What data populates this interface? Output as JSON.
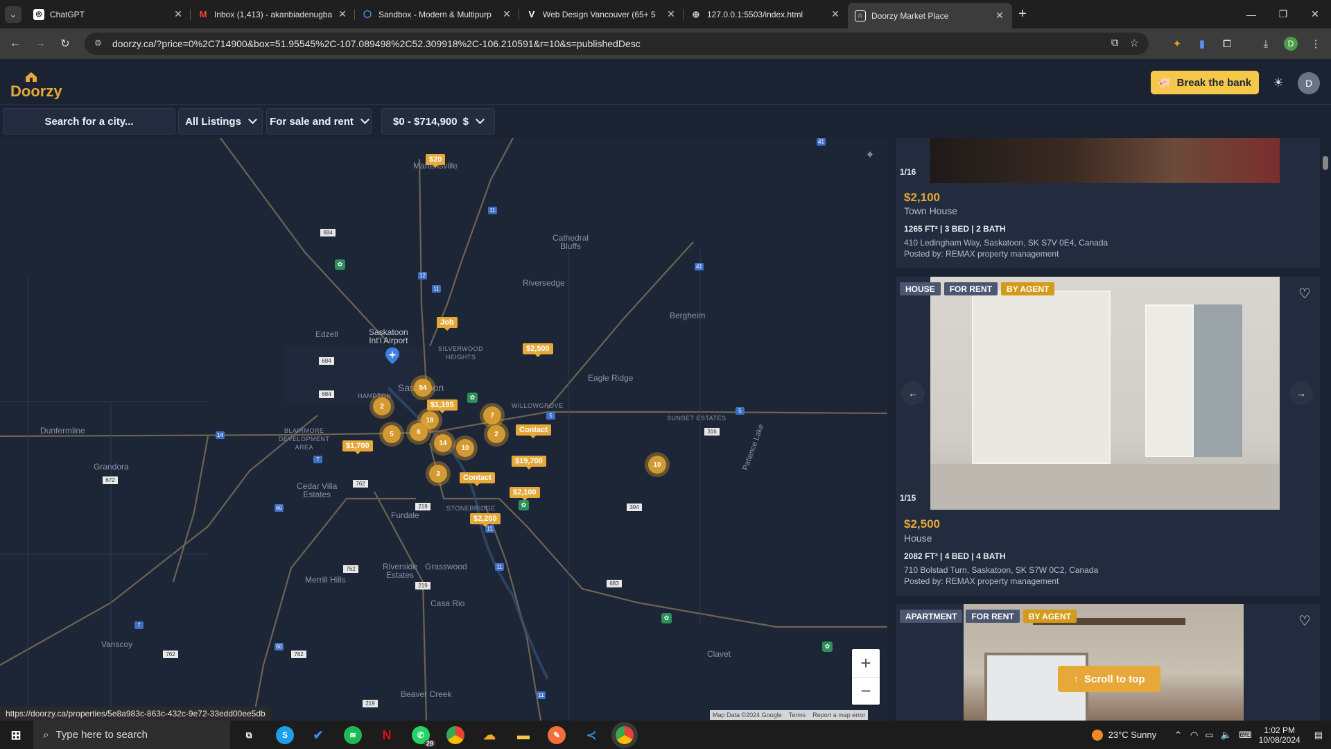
{
  "browser": {
    "tabs": [
      {
        "title": "ChatGPT",
        "favicon": "chatgpt-icon",
        "active": false
      },
      {
        "title": "Inbox (1,413) - akanbiadenugba",
        "favicon": "gmail-icon",
        "active": false
      },
      {
        "title": "Sandbox - Modern & Multipurp",
        "favicon": "sandbox-icon",
        "active": false
      },
      {
        "title": "Web Design Vancouver (65+ 5",
        "favicon": "vercel-icon",
        "active": false
      },
      {
        "title": "127.0.0.1:5503/index.html",
        "favicon": "globe-icon",
        "active": false
      },
      {
        "title": "Doorzy Market Place",
        "favicon": "doorzy-icon",
        "active": true
      }
    ],
    "url": "doorzy.ca/?price=0%2C714900&box=51.95545%2C-107.089498%2C52.309918%2C-106.210591&r=10&s=publishedDesc",
    "profile_initial": "D",
    "status_url": "https://doorzy.ca/properties/5e8a983c-863c-432c-9e72-33edd00ee5db"
  },
  "header": {
    "logo_text": "Doorzy",
    "break_bank_label": "Break the bank",
    "avatar_initial": "D"
  },
  "filters": {
    "search_placeholder": "Search for a city...",
    "listings": "All Listings",
    "sale_rent": "For sale and rent",
    "price_range": "$0 - $714,900",
    "currency": "$"
  },
  "map": {
    "labels": {
      "martensville": "Martensville",
      "cathedral_bluffs": "Cathedral\nBluffs",
      "riversedge": "Riversedge",
      "bergheim": "Bergheim",
      "edzell": "Edzell",
      "airport": "Saskatoon\nInt'l Airport",
      "silverwood": "SILVERWOOD\nHEIGHTS",
      "eagle_ridge": "Eagle Ridge",
      "willowgrove": "WILLOWGROVE",
      "sunset_estates": "SUNSET ESTATES",
      "saskatoon": "Saskatoon",
      "hampton": "HAMPTON",
      "dunfermline": "Dunfermline",
      "blairmore": "BLAIRMORE\nDEVELOPMENT\nAREA",
      "grandora": "Grandora",
      "cedar_villa": "Cedar Villa\nEstates",
      "furdale": "Furdale",
      "stonebridge": "STONEBRIDGE",
      "riverside": "Riverside\nEstates",
      "grasswood": "Grasswood",
      "merrill_hills": "Merrill Hills",
      "casa_rio": "Casa Rio",
      "vanscoy": "Vanscoy",
      "clavet": "Clavet",
      "beaver_creek": "Beaver Creek",
      "patience_lake": "Patience Lake"
    },
    "price_tags": [
      "$20",
      "Job",
      "$2,500",
      "$1,195",
      "Contact",
      "$1,700",
      "$19,700",
      "Contact",
      "$2,100",
      "$2,200"
    ],
    "clusters": [
      "54",
      "2",
      "19",
      "7",
      "5",
      "6",
      "2",
      "14",
      "10",
      "3",
      "10"
    ],
    "attribution": [
      "Map Data ©2024 Google",
      "Terms",
      "Report a map error"
    ]
  },
  "listings": [
    {
      "counter": "1/16",
      "price": "$2,100",
      "type": "Town House",
      "specs": "1265 FT² | 3 BED | 2 BATH",
      "address": "410 Ledingham Way, Saskatoon, SK S7V 0E4, Canada",
      "posted": "Posted by: REMAX property management"
    },
    {
      "badges": [
        "HOUSE",
        "FOR RENT",
        "BY AGENT"
      ],
      "counter": "1/15",
      "price": "$2,500",
      "type": "House",
      "specs": "2082 FT² | 4 BED | 4 BATH",
      "address": "710 Bolstad Turn, Saskatoon, SK S7W 0C2, Canada",
      "posted": "Posted by: REMAX property management"
    },
    {
      "badges": [
        "APARTMENT",
        "FOR RENT",
        "BY AGENT"
      ]
    }
  ],
  "scroll_top_label": "Scroll to top",
  "taskbar": {
    "search_placeholder": "Type here to search",
    "whatsapp_badge": "29",
    "weather": "23°C  Sunny",
    "time": "1:02 PM",
    "date": "10/08/2024"
  },
  "colors": {
    "accent": "#e7a83a",
    "background": "#1b2333",
    "button_yellow": "#f5c84c"
  }
}
